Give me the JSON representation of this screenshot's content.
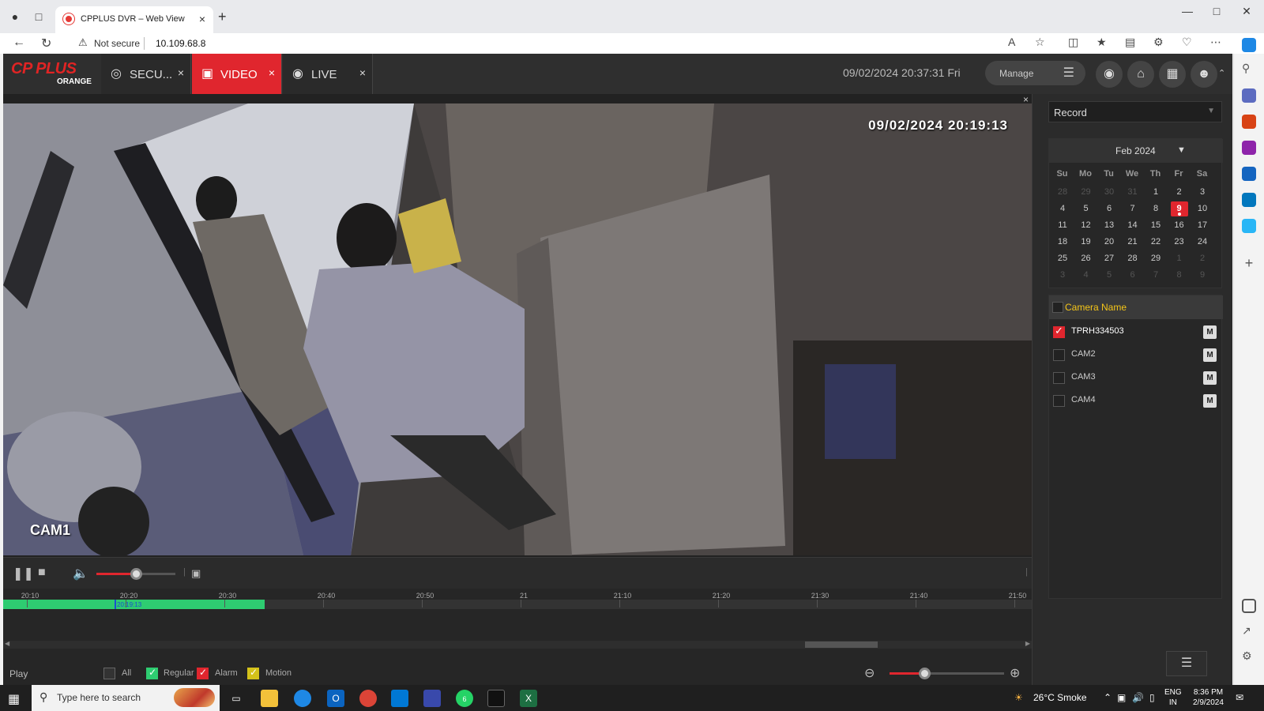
{
  "browser": {
    "tab_title": "CPPLUS DVR – Web View",
    "security_label": "Not secure",
    "url": "10.109.68.8"
  },
  "app": {
    "logo_text": "CP PLUS",
    "logo_sub": "ORANGE",
    "tabs": [
      {
        "label": "SECU...",
        "icon": "security-icon"
      },
      {
        "label": "VIDEO",
        "icon": "video-icon",
        "active": true
      },
      {
        "label": "LIVE",
        "icon": "eye-icon"
      }
    ],
    "datetime": "09/02/2024 20:37:31 Fri",
    "manage_label": "Manage",
    "accent_color": "#e0262e"
  },
  "video": {
    "osd_timestamp": "09/02/2024 20:19:13",
    "camera_label": "CAM1",
    "volume_level": 0.5
  },
  "timeline": {
    "ticks": [
      "20:10",
      "20:20",
      "20:30",
      "20:40",
      "20:50",
      "21",
      "21:10",
      "21:20",
      "21:30",
      "21:40",
      "21:50"
    ],
    "playhead_label": "20:19:13",
    "recorded_color": "#2ecc71"
  },
  "bottom": {
    "play_label": "Play",
    "filters": [
      {
        "label": "All",
        "checked": false
      },
      {
        "label": "Regular",
        "checked": true,
        "color": "#2ecc71"
      },
      {
        "label": "Alarm",
        "checked": true,
        "color": "#e0262e"
      },
      {
        "label": "Motion",
        "checked": true,
        "color": "#d4c21a"
      }
    ],
    "zoom_level": 0.3
  },
  "sidepanel": {
    "record_select": "Record",
    "calendar": {
      "month_label": "Feb 2024",
      "weekdays": [
        "Su",
        "Mo",
        "Tu",
        "We",
        "Th",
        "Fr",
        "Sa"
      ],
      "weeks": [
        [
          "28",
          "29",
          "30",
          "31",
          "1",
          "2",
          "3"
        ],
        [
          "4",
          "5",
          "6",
          "7",
          "8",
          "9",
          "10"
        ],
        [
          "11",
          "12",
          "13",
          "14",
          "15",
          "16",
          "17"
        ],
        [
          "18",
          "19",
          "20",
          "21",
          "22",
          "23",
          "24"
        ],
        [
          "25",
          "26",
          "27",
          "28",
          "29",
          "1",
          "2"
        ],
        [
          "3",
          "4",
          "5",
          "6",
          "7",
          "8",
          "9"
        ]
      ],
      "selected_day": "9"
    },
    "camera_header": "Camera Name",
    "cameras": [
      {
        "name": "TPRH334503",
        "checked": true,
        "mode": "M"
      },
      {
        "name": "CAM2",
        "checked": false,
        "mode": "M"
      },
      {
        "name": "CAM3",
        "checked": false,
        "mode": "M"
      },
      {
        "name": "CAM4",
        "checked": false,
        "mode": "M"
      }
    ]
  },
  "taskbar": {
    "search_placeholder": "Type here to search",
    "weather": "26°C  Smoke",
    "lang_top": "ENG",
    "lang_bottom": "IN",
    "time": "8:36 PM",
    "date": "2/9/2024",
    "whatsapp_badge": "6"
  }
}
